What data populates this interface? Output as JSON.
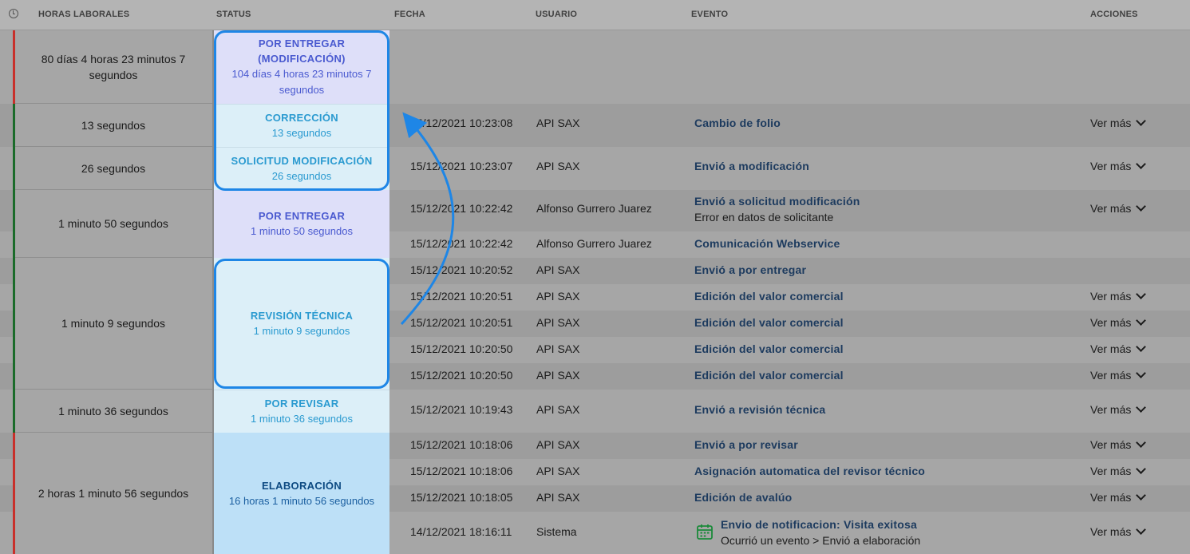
{
  "header": {
    "clock_icon": "clock-icon",
    "horas": "HORAS LABORALES",
    "status": "STATUS",
    "fecha": "FECHA",
    "usuario": "USUARIO",
    "evento": "EVENTO",
    "acciones": "ACCIONES"
  },
  "groups": [
    {
      "hours": "80 días 4 horas 23 minutos 7 segundos",
      "bar": "#c8302b",
      "status": "POR ENTREGAR (MODIFICACIÓN)",
      "duration": "104 días 4 horas 23 minutos 7 segundos"
    },
    {
      "hours": "13 segundos",
      "bar": "#1b6b2a",
      "status": "CORRECCIÓN",
      "duration": "13 segundos"
    },
    {
      "hours": "26 segundos",
      "bar": "#1b6b2a",
      "status": "SOLICITUD MODIFICACIÓN",
      "duration": "26 segundos"
    },
    {
      "hours": "1 minuto 50 segundos",
      "bar": "#1b6b2a",
      "status": "POR ENTREGAR",
      "duration": "1 minuto 50 segundos"
    },
    {
      "hours": "1 minuto 9 segundos",
      "bar": "#1b6b2a",
      "status": "REVISIÓN TÉCNICA",
      "duration": "1 minuto 9 segundos"
    },
    {
      "hours": "1 minuto 36 segundos",
      "bar": "#1b6b2a",
      "status": "POR REVISAR",
      "duration": "1 minuto 36 segundos"
    },
    {
      "hours": "2 horas 1 minuto 56 segundos",
      "bar": "#c8302b",
      "status": "ELABORACIÓN",
      "duration": "16 horas 1 minuto 56 segundos"
    }
  ],
  "events": [
    {
      "date": "15/12/2021 10:23:08",
      "user": "API SAX",
      "event": "Cambio de folio",
      "desc": "",
      "action": "Ver más"
    },
    {
      "date": "15/12/2021 10:23:07",
      "user": "API SAX",
      "event": "Envió a modificación",
      "desc": "",
      "action": "Ver más"
    },
    {
      "date": "15/12/2021 10:22:42",
      "user": "Alfonso Gurrero Juarez",
      "event": "Envió a solicitud modificación",
      "desc": "Error en datos de solicitante",
      "action": "Ver más"
    },
    {
      "date": "15/12/2021 10:22:42",
      "user": "Alfonso Gurrero Juarez",
      "event": "Comunicación Webservice",
      "desc": "",
      "action": ""
    },
    {
      "date": "15/12/2021 10:20:52",
      "user": "API SAX",
      "event": "Envió a por entregar",
      "desc": "",
      "action": ""
    },
    {
      "date": "15/12/2021 10:20:51",
      "user": "API SAX",
      "event": "Edición del valor comercial",
      "desc": "",
      "action": "Ver más"
    },
    {
      "date": "15/12/2021 10:20:51",
      "user": "API SAX",
      "event": "Edición del valor comercial",
      "desc": "",
      "action": "Ver más"
    },
    {
      "date": "15/12/2021 10:20:50",
      "user": "API SAX",
      "event": "Edición del valor comercial",
      "desc": "",
      "action": "Ver más"
    },
    {
      "date": "15/12/2021 10:20:50",
      "user": "API SAX",
      "event": "Edición del valor comercial",
      "desc": "",
      "action": "Ver más"
    },
    {
      "date": "15/12/2021 10:19:43",
      "user": "API SAX",
      "event": "Envió a revisión técnica",
      "desc": "",
      "action": "Ver más"
    },
    {
      "date": "15/12/2021 10:18:06",
      "user": "API SAX",
      "event": "Envió a por revisar",
      "desc": "",
      "action": "Ver más"
    },
    {
      "date": "15/12/2021 10:18:06",
      "user": "API SAX",
      "event": "Asignación automatica del revisor técnico",
      "desc": "",
      "action": "Ver más"
    },
    {
      "date": "15/12/2021 10:18:05",
      "user": "API SAX",
      "event": "Edición de avalúo",
      "desc": "",
      "action": "Ver más"
    },
    {
      "date": "14/12/2021 18:16:11",
      "user": "Sistema",
      "event": "Envio de notificacion: Visita exitosa",
      "desc": "Ocurrió un evento > Envió a elaboración",
      "action": "Ver más",
      "icon": "calendar-icon"
    }
  ],
  "colors": {
    "accent_highlight": "#1e86e6",
    "event_text": "#1c3a5e",
    "status_bar_red": "#c8302b",
    "status_bar_green": "#1b6b2a"
  }
}
